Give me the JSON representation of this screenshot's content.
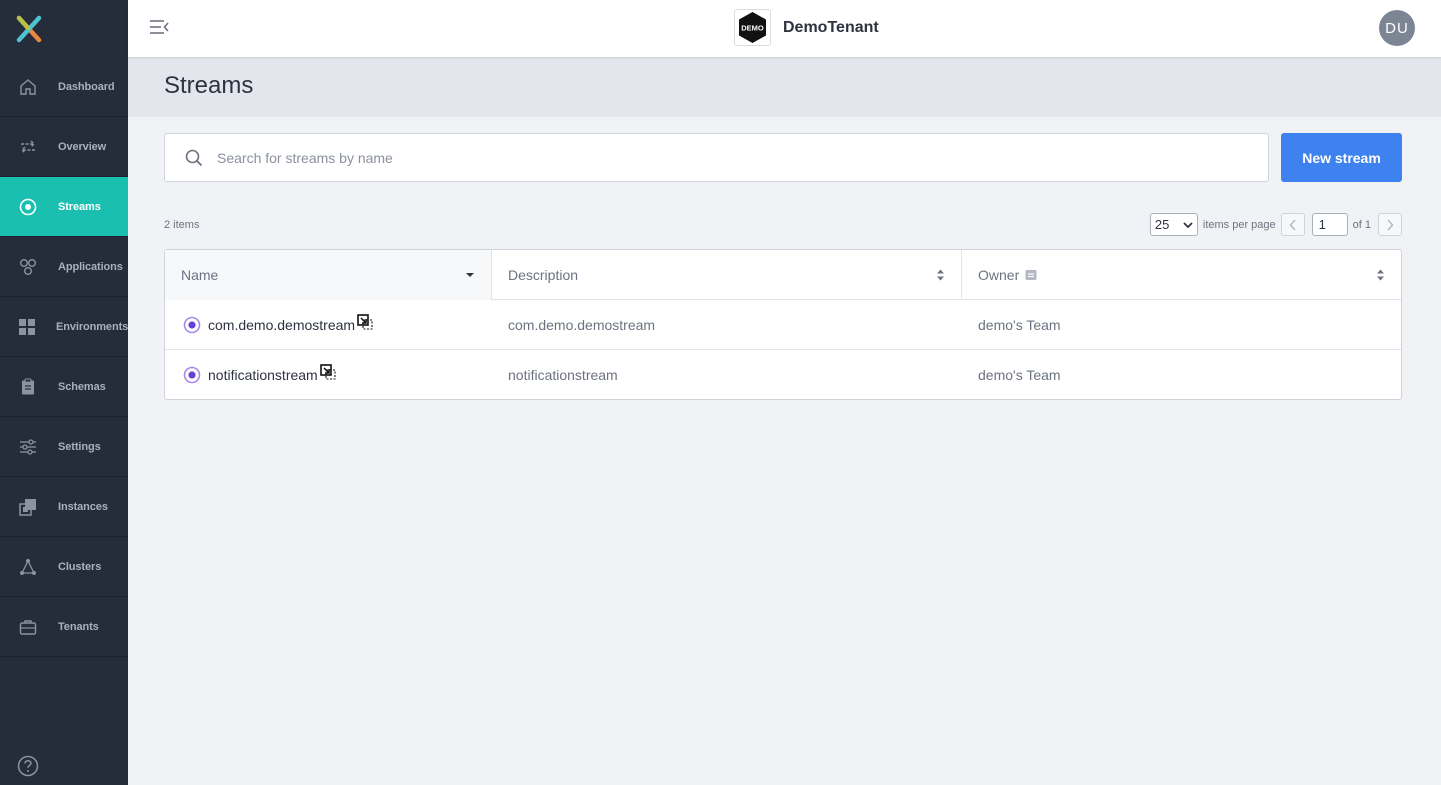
{
  "app": {
    "tenant_name": "DemoTenant",
    "tenant_logo_text": "DEMO",
    "user_initials": "DU"
  },
  "sidebar": {
    "items": [
      {
        "label": "Dashboard",
        "icon": "home-icon",
        "active": false
      },
      {
        "label": "Overview",
        "icon": "arrows-exchange-icon",
        "active": false
      },
      {
        "label": "Streams",
        "icon": "target-icon",
        "active": true
      },
      {
        "label": "Applications",
        "icon": "applications-icon",
        "active": false
      },
      {
        "label": "Environments",
        "icon": "grid-icon",
        "active": false
      },
      {
        "label": "Schemas",
        "icon": "clipboard-icon",
        "active": false
      },
      {
        "label": "Settings",
        "icon": "sliders-icon",
        "active": false
      },
      {
        "label": "Instances",
        "icon": "instances-icon",
        "active": false
      },
      {
        "label": "Clusters",
        "icon": "cluster-icon",
        "active": false
      },
      {
        "label": "Tenants",
        "icon": "briefcase-icon",
        "active": false
      }
    ],
    "help_icon": "help-circle-icon"
  },
  "page": {
    "title": "Streams"
  },
  "search": {
    "placeholder": "Search for streams by name",
    "value": ""
  },
  "toolbar": {
    "new_button_label": "New stream"
  },
  "pagination": {
    "item_count_label": "2 items",
    "per_page_value": "25",
    "per_page_label": "items per page",
    "current_page": "1",
    "of_label": "of 1"
  },
  "table": {
    "columns": [
      {
        "label": "Name"
      },
      {
        "label": "Description"
      },
      {
        "label": "Owner"
      }
    ],
    "rows": [
      {
        "name": "com.demo.demostream",
        "description": "com.demo.demostream",
        "owner": "demo's Team"
      },
      {
        "name": "notificationstream",
        "description": "notificationstream",
        "owner": "demo's Team"
      }
    ]
  },
  "colors": {
    "sidebar_bg": "#262d3a",
    "active_accent": "#1bbfb0",
    "primary_button": "#3d82ee",
    "stream_icon": "#6a3fd8"
  }
}
